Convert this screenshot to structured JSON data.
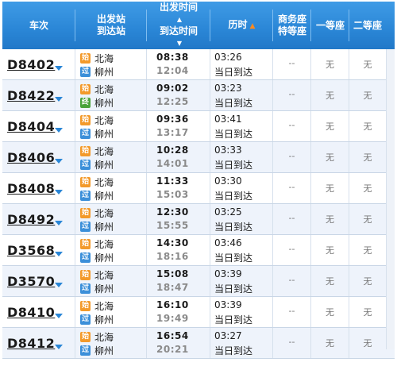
{
  "header": {
    "train": "车次",
    "stations": [
      "出发站",
      "到达站"
    ],
    "times": [
      "出发时间",
      "到达时间"
    ],
    "duration": "历时",
    "business": [
      "商务座",
      "特等座"
    ],
    "first": "一等座",
    "second": "二等座"
  },
  "colors": {
    "header": "#2a86d6",
    "start_badge": "#f39a2b",
    "pass_badge": "#3b8fd9",
    "end_badge": "#4aa33a",
    "active_sort": "#ff8a1f"
  },
  "rows": [
    {
      "train": "D8402",
      "from_badge": "始",
      "from": "北海",
      "to_badge": "过",
      "to": "柳州",
      "dep": "08:38",
      "arr": "12:04",
      "duration": "03:26",
      "note": "当日到达",
      "business": "--",
      "first": "无",
      "second": "无"
    },
    {
      "train": "D8422",
      "from_badge": "始",
      "from": "北海",
      "to_badge": "终",
      "to": "柳州",
      "dep": "09:02",
      "arr": "12:25",
      "duration": "03:23",
      "note": "当日到达",
      "business": "--",
      "first": "无",
      "second": "无"
    },
    {
      "train": "D8404",
      "from_badge": "始",
      "from": "北海",
      "to_badge": "过",
      "to": "柳州",
      "dep": "09:36",
      "arr": "13:17",
      "duration": "03:41",
      "note": "当日到达",
      "business": "--",
      "first": "无",
      "second": "无"
    },
    {
      "train": "D8406",
      "from_badge": "始",
      "from": "北海",
      "to_badge": "过",
      "to": "柳州",
      "dep": "10:28",
      "arr": "14:01",
      "duration": "03:33",
      "note": "当日到达",
      "business": "--",
      "first": "无",
      "second": "无"
    },
    {
      "train": "D8408",
      "from_badge": "始",
      "from": "北海",
      "to_badge": "过",
      "to": "柳州",
      "dep": "11:33",
      "arr": "15:03",
      "duration": "03:30",
      "note": "当日到达",
      "business": "--",
      "first": "无",
      "second": "无"
    },
    {
      "train": "D8492",
      "from_badge": "始",
      "from": "北海",
      "to_badge": "过",
      "to": "柳州",
      "dep": "12:30",
      "arr": "15:55",
      "duration": "03:25",
      "note": "当日到达",
      "business": "--",
      "first": "无",
      "second": "无"
    },
    {
      "train": "D3568",
      "from_badge": "始",
      "from": "北海",
      "to_badge": "过",
      "to": "柳州",
      "dep": "14:30",
      "arr": "18:16",
      "duration": "03:46",
      "note": "当日到达",
      "business": "--",
      "first": "无",
      "second": "无"
    },
    {
      "train": "D3570",
      "from_badge": "始",
      "from": "北海",
      "to_badge": "过",
      "to": "柳州",
      "dep": "15:08",
      "arr": "18:47",
      "duration": "03:39",
      "note": "当日到达",
      "business": "--",
      "first": "无",
      "second": "无"
    },
    {
      "train": "D8410",
      "from_badge": "始",
      "from": "北海",
      "to_badge": "过",
      "to": "柳州",
      "dep": "16:10",
      "arr": "19:49",
      "duration": "03:39",
      "note": "当日到达",
      "business": "--",
      "first": "无",
      "second": "无"
    },
    {
      "train": "D8412",
      "from_badge": "始",
      "from": "北海",
      "to_badge": "过",
      "to": "柳州",
      "dep": "16:54",
      "arr": "20:21",
      "duration": "03:27",
      "note": "当日到达",
      "business": "--",
      "first": "无",
      "second": "无"
    }
  ]
}
